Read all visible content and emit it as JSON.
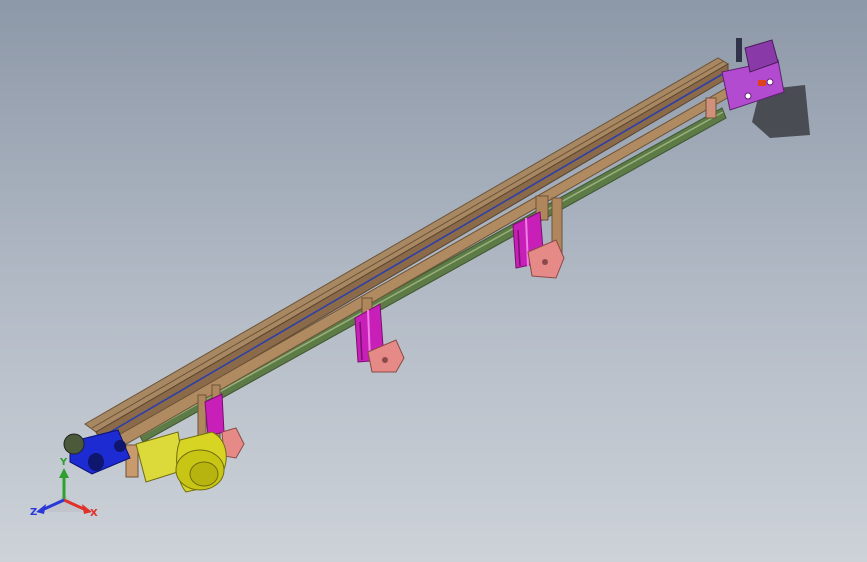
{
  "viewport": {
    "background_top": "#8d98a8",
    "background_bottom": "#cdd2d8"
  },
  "model": {
    "rail_color": "#9a7c5a",
    "guide_color": "#5d7b46",
    "leg_color": "#c71fb8",
    "bracket_color": "#e58a86",
    "motor_color": "#d7d423",
    "drive_cap_color": "#1d2bd2",
    "end_block_color": "#b24bd0"
  },
  "triad": {
    "x_label": "X",
    "y_label": "Y",
    "z_label": "Z",
    "x_color": "#e0312a",
    "y_color": "#2ea02e",
    "z_color": "#2a38d8"
  }
}
